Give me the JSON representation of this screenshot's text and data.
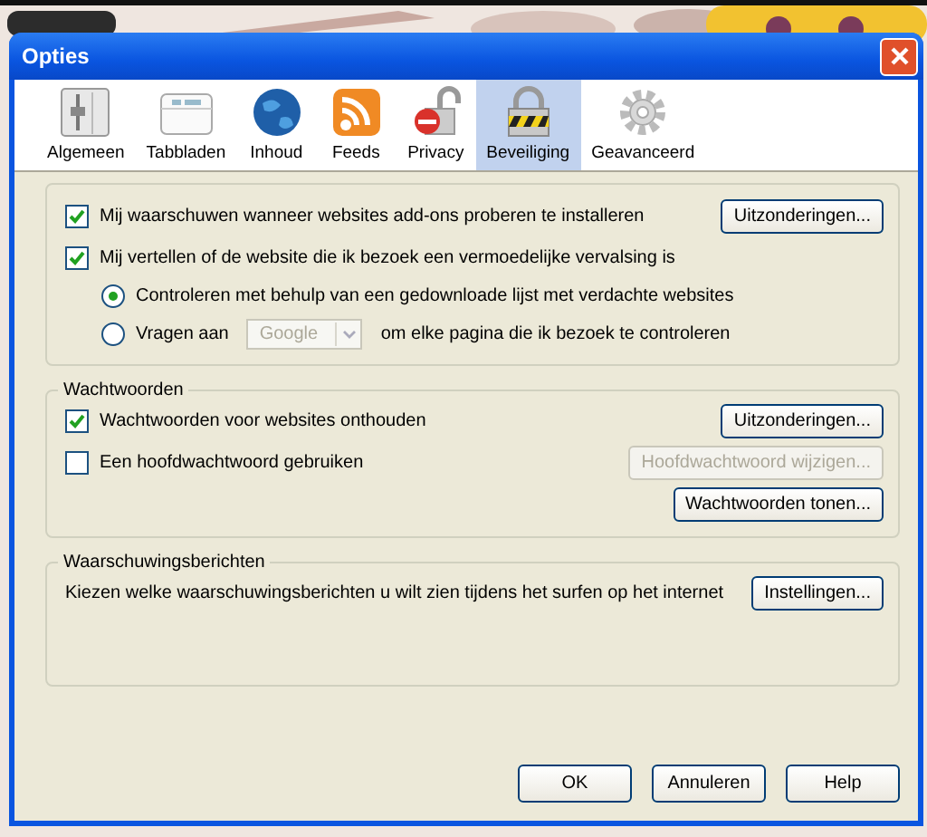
{
  "window": {
    "title": "Opties"
  },
  "tabs": [
    {
      "label": "Algemeen",
      "kind": "sliders",
      "selected": false
    },
    {
      "label": "Tabbladen",
      "kind": "tabs",
      "selected": false
    },
    {
      "label": "Inhoud",
      "kind": "globe",
      "selected": false
    },
    {
      "label": "Feeds",
      "kind": "feed",
      "selected": false
    },
    {
      "label": "Privacy",
      "kind": "unlock",
      "selected": false
    },
    {
      "label": "Beveiliging",
      "kind": "lock",
      "selected": true
    },
    {
      "label": "Geavanceerd",
      "kind": "gear",
      "selected": false
    }
  ],
  "general": {
    "rows": [
      {
        "kind": "checkbox",
        "label": "Mij waarschuwen wanneer websites add-ons proberen te installeren",
        "checked": true,
        "button": "Uitzonderingen..."
      },
      {
        "kind": "checkbox",
        "label": "Mij vertellen of de website die ik bezoek een vermoedelijke vervalsing is",
        "checked": true
      },
      {
        "kind": "radio",
        "label": "Controleren met behulp van een gedownloade lijst met verdachte websites",
        "selected": true
      },
      {
        "kind": "radio",
        "label": "Vragen aan",
        "selected": false,
        "dropdown": "Google",
        "after": "om elke pagina die ik bezoek te controleren"
      }
    ]
  },
  "passwords": {
    "title": "Wachtwoorden",
    "rows": [
      {
        "label": "Wachtwoorden voor websites onthouden",
        "checked": true,
        "button": "Uitzonderingen...",
        "disabled": false
      },
      {
        "label": "Een hoofdwachtwoord gebruiken",
        "checked": false,
        "button": "Hoofdwachtwoord wijzigen...",
        "disabled": true
      }
    ],
    "show_button": "Wachtwoorden tonen..."
  },
  "warnings": {
    "title": "Waarschuwingsberichten",
    "text": "Kiezen welke waarschuwingsberichten u wilt zien tijdens het surfen op het internet",
    "button": "Instellingen..."
  },
  "buttons": [
    "OK",
    "Annuleren",
    "Help"
  ]
}
